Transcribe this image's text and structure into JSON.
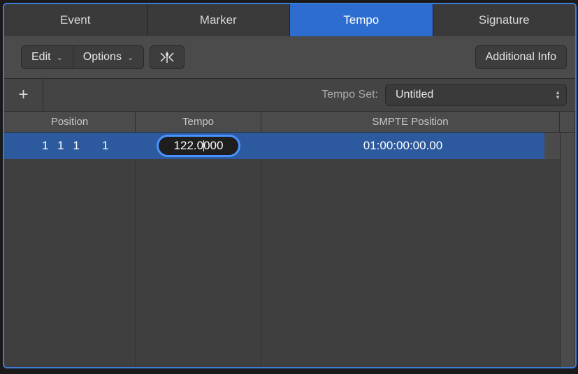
{
  "tabs": [
    {
      "label": "Event",
      "active": false
    },
    {
      "label": "Marker",
      "active": false
    },
    {
      "label": "Tempo",
      "active": true
    },
    {
      "label": "Signature",
      "active": false
    }
  ],
  "toolbar": {
    "edit_label": "Edit",
    "options_label": "Options",
    "additional_info_label": "Additional Info"
  },
  "tempo_set": {
    "label": "Tempo Set:",
    "value": "Untitled"
  },
  "columns": {
    "position": "Position",
    "tempo": "Tempo",
    "smpte": "SMPTE Position"
  },
  "rows": [
    {
      "position_bars": "1 1 1",
      "position_sub": "1",
      "tempo": "122.0000",
      "smpte": "01:00:00:00.00",
      "selected": true,
      "editing": true
    }
  ]
}
